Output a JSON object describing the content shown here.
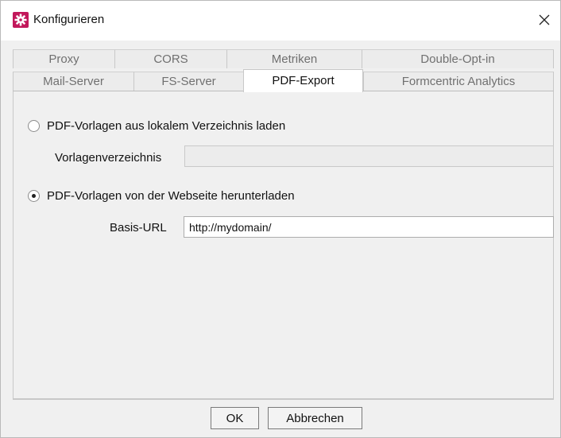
{
  "window": {
    "title": "Konfigurieren",
    "close_glyph": "✕",
    "icon_color": "#c2185b"
  },
  "tabs": {
    "row1": [
      "Proxy",
      "CORS",
      "Metriken",
      "Double-Opt-in"
    ],
    "row2": [
      "Mail-Server",
      "FS-Server",
      "PDF-Export",
      "Formcentric Analytics"
    ],
    "active": "PDF-Export"
  },
  "pdf_export": {
    "option_local": {
      "label": "PDF-Vorlagen aus lokalem Verzeichnis laden",
      "selected": false
    },
    "directory": {
      "label": "Vorlagenverzeichnis",
      "value": ""
    },
    "option_web": {
      "label": "PDF-Vorlagen von der Webseite herunterladen",
      "selected": true
    },
    "base_url": {
      "label": "Basis-URL",
      "value": "http://mydomain/"
    }
  },
  "buttons": {
    "ok": "OK",
    "cancel": "Abbrechen"
  }
}
